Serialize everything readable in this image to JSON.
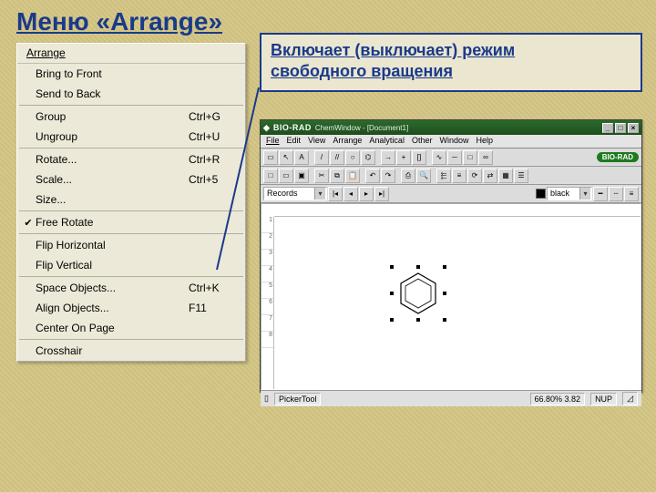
{
  "title": "Меню «Arrange»",
  "callout": {
    "line1": "Включает (выключает) режим",
    "line2": "свободного вращения"
  },
  "menu": {
    "header": "Arrange",
    "items": [
      {
        "label": "Bring to Front",
        "shortcut": "",
        "checked": false
      },
      {
        "label": "Send to Back",
        "shortcut": "",
        "checked": false
      },
      {
        "sep": true
      },
      {
        "label": "Group",
        "shortcut": "Ctrl+G",
        "checked": false
      },
      {
        "label": "Ungroup",
        "shortcut": "Ctrl+U",
        "checked": false
      },
      {
        "sep": true
      },
      {
        "label": "Rotate...",
        "shortcut": "Ctrl+R",
        "checked": false
      },
      {
        "label": "Scale...",
        "shortcut": "Ctrl+5",
        "checked": false
      },
      {
        "label": "Size...",
        "shortcut": "",
        "checked": false
      },
      {
        "sep": true
      },
      {
        "label": "Free Rotate",
        "shortcut": "",
        "checked": true
      },
      {
        "sep": true
      },
      {
        "label": "Flip Horizontal",
        "shortcut": "",
        "checked": false
      },
      {
        "label": "Flip Vertical",
        "shortcut": "",
        "checked": false
      },
      {
        "sep": true
      },
      {
        "label": "Space Objects...",
        "shortcut": "Ctrl+K",
        "checked": false
      },
      {
        "label": "Align Objects...",
        "shortcut": "F11",
        "checked": false
      },
      {
        "label": "Center On Page",
        "shortcut": "",
        "checked": false
      },
      {
        "sep": true
      },
      {
        "label": "Crosshair",
        "shortcut": "",
        "checked": false
      }
    ]
  },
  "chemwin": {
    "brand": "BIO-RAD",
    "titleDoc": "ChemWindow - [Document1]",
    "menus": [
      "File",
      "Edit",
      "View",
      "Arrange",
      "Analytical",
      "Other",
      "Window",
      "Help"
    ],
    "biorad_pill": "BIO-RAD",
    "recordCombo": "Records",
    "colorLabel": "black",
    "ruler_ticks": [
      "1",
      "2",
      "3",
      "4",
      "5",
      "6",
      "7",
      "8"
    ],
    "status": {
      "picker": "PickerTool",
      "zoom": "66.80% 3.82",
      "mode": "NUP"
    },
    "winbuttons": [
      "_",
      "□",
      "×"
    ]
  }
}
